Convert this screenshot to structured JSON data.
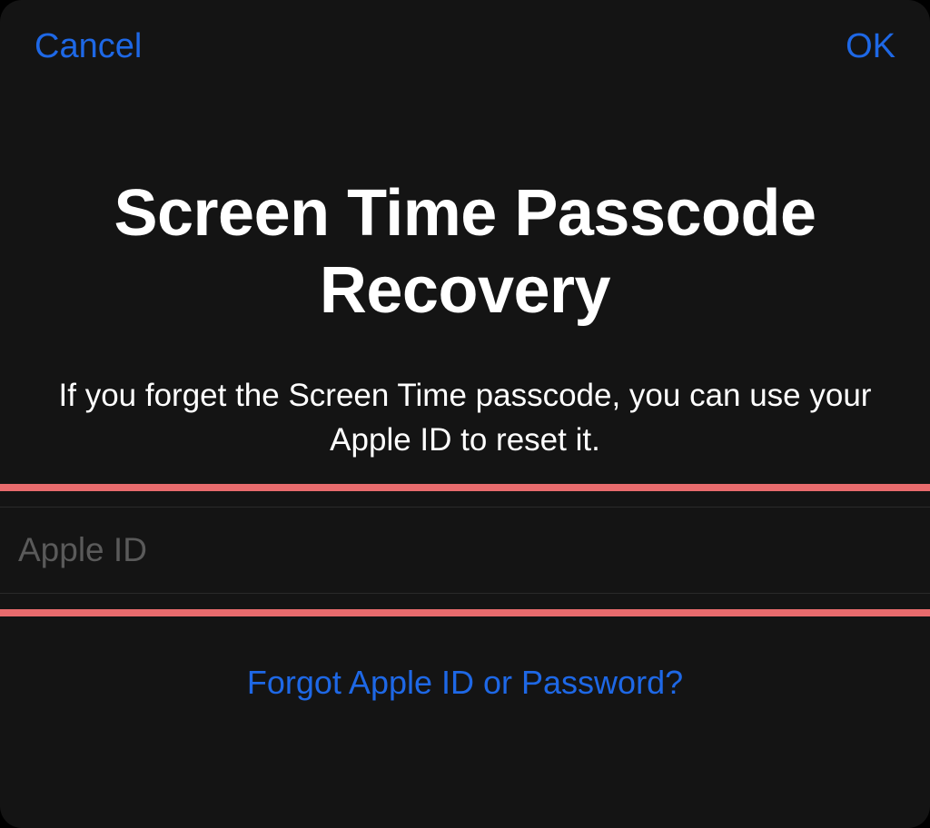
{
  "header": {
    "cancel_label": "Cancel",
    "ok_label": "OK"
  },
  "main": {
    "title": "Screen Time Passcode Recovery",
    "subtitle": "If you forget the Screen Time passcode, you can use your Apple ID to reset it.",
    "apple_id_placeholder": "Apple ID",
    "forgot_link": "Forgot Apple ID or Password?"
  }
}
